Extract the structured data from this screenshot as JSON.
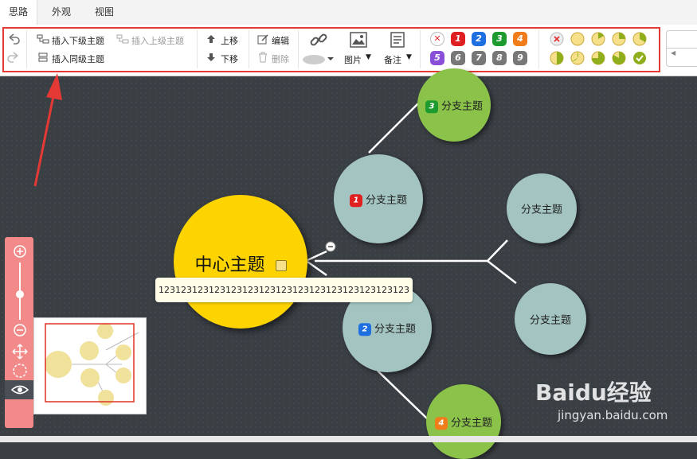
{
  "tabs": [
    "思路",
    "外观",
    "视图"
  ],
  "toolbar": {
    "insert_child": "插入下级主题",
    "insert_parent": "插入上级主题",
    "insert_sibling": "插入同级主题",
    "move_up": "上移",
    "move_down": "下移",
    "edit": "编辑",
    "delete": "删除",
    "image": "图片",
    "note": "备注",
    "priorities": [
      {
        "label": "✕",
        "color": "#e8e8e8"
      },
      {
        "label": "1",
        "color": "#e02020"
      },
      {
        "label": "2",
        "color": "#1e6fe0"
      },
      {
        "label": "3",
        "color": "#1e9b2e"
      },
      {
        "label": "4",
        "color": "#f07d1a"
      },
      {
        "label": "5",
        "color": "#8a4fd8"
      },
      {
        "label": "6",
        "color": "#777777"
      },
      {
        "label": "7",
        "color": "#777777"
      },
      {
        "label": "8",
        "color": "#777777"
      },
      {
        "label": "9",
        "color": "#777777"
      }
    ]
  },
  "mindmap": {
    "center": "中心主题",
    "branch1": "分支主题",
    "branch2": "分支主题",
    "branch3": "分支主题",
    "branch4": "分支主题",
    "branch5": "分支主题",
    "branch6": "分支主题",
    "tooltip": "123123123123123123123123123123123123123123123"
  },
  "watermark": {
    "brand": "Baidu经验",
    "url": "jingyan.baidu.com"
  },
  "colors": {
    "accent": "#e53935",
    "center": "#fdd400",
    "branch": "#a3c4c0",
    "leaf": "#8bc34a",
    "canvas": "#3a3f44",
    "zoom": "#f28a8a"
  }
}
